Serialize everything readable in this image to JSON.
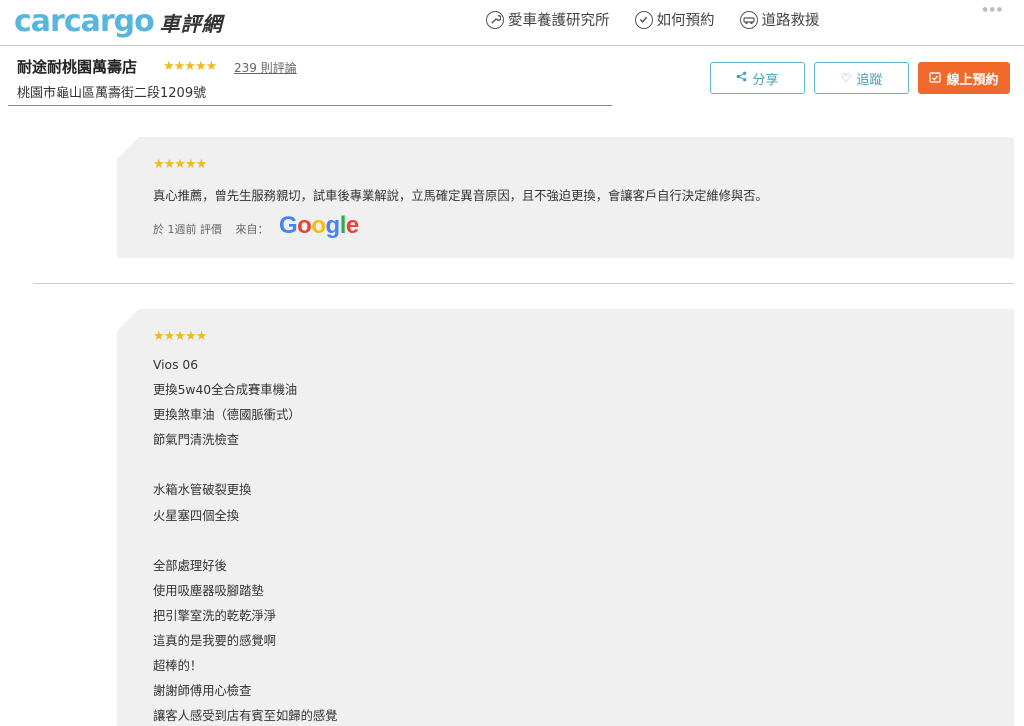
{
  "nav": {
    "logo_text": "carcargo",
    "logo_cn": "車評網",
    "links": [
      {
        "label": "愛車養護研究所",
        "icon": "wrench-icon"
      },
      {
        "label": "如何預約",
        "icon": "check-circle-icon"
      },
      {
        "label": "道路救援",
        "icon": "tow-truck-icon"
      }
    ]
  },
  "shop": {
    "name": "耐途耐桃園萬壽店",
    "stars": "★★★★★",
    "review_count": "239 則評論",
    "address": "桃園市龜山區萬壽街二段1209號"
  },
  "actions": {
    "share": "分享",
    "follow": "追蹤",
    "book": "線上預約"
  },
  "reviews": [
    {
      "stars": "★★★★★",
      "text": "真心推薦，曾先生服務親切，試車後專業解說，立馬確定異音原因，且不強迫更換，會讓客戶自行決定維修與否。",
      "meta_time": "於 1週前  評價",
      "meta_from": "來自：",
      "source": "Google"
    },
    {
      "stars": "★★★★★",
      "lines": [
        "Vios 06",
        "更換5w40全合成賽車機油",
        "更換煞車油（德國脈衝式）",
        "節氣門清洗檢查",
        "",
        "水箱水管破裂更換",
        "火星塞四個全換",
        "",
        "全部處理好後",
        "使用吸塵器吸腳踏墊",
        "把引擎室洗的乾乾淨淨",
        "這真的是我要的感覺啊",
        "超棒的！",
        "謝謝師傅用心檢查",
        "讓客人感受到店有賓至如歸的感覺"
      ]
    }
  ]
}
